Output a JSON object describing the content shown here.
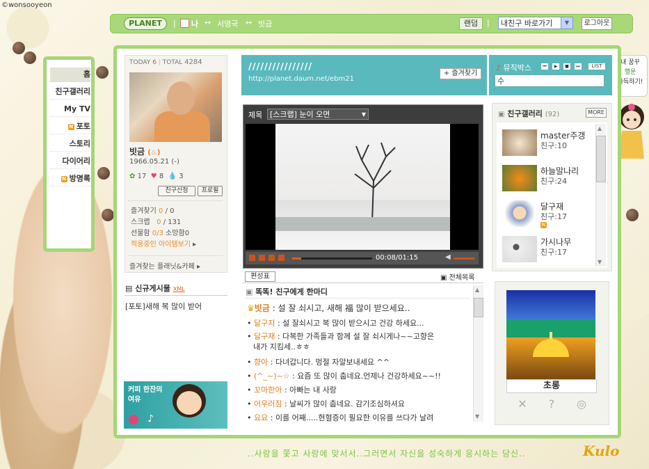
{
  "watermark": "©wonsooyeon",
  "nav": {
    "logo": "PLANET",
    "me": "나",
    "arrow": "↔",
    "person1": "서영국",
    "person2": "빗금",
    "random": "랜덤",
    "friend_select": "내친구 바로가기",
    "logout": "로그아웃"
  },
  "menu": {
    "items": [
      {
        "label": "홈",
        "new": false
      },
      {
        "label": "친구갤러리",
        "new": false
      },
      {
        "label": "My TV",
        "new": false
      },
      {
        "label": "포토",
        "new": true
      },
      {
        "label": "스토리",
        "new": false
      },
      {
        "label": "다이어리",
        "new": false
      },
      {
        "label": "방명록",
        "new": true
      }
    ],
    "new_badge": "N"
  },
  "profile": {
    "today_label": "TODAY",
    "today_value": "6",
    "total_label": "TOTAL",
    "total_value": "4284",
    "name": "빗금",
    "birth": "1966.05.21 (-)",
    "stat1": "17",
    "stat2": "8",
    "stat3": "3",
    "btn_friend": "친구신청",
    "btn_profile": "프로필",
    "fav_label": "즐겨찾기",
    "fav_value": "0",
    "fav_total": "/ 0",
    "scrap_label": "스크랩",
    "scrap_value": "0",
    "scrap_total": "/ 131",
    "gift_label": "선물함",
    "gift_value": "0/3",
    "wish_label": "소망함",
    "wish_value": "0",
    "items_link": "적용중인 아이템보기",
    "planet_link": "즐겨찾는 플래닛&카페",
    "new_posts_title": "신규게시물",
    "xml": "XML",
    "new_post_item": "[포토]새해 복 많이 받어",
    "ad_line1": "커피 한잔의",
    "ad_line2": "여유"
  },
  "banner": {
    "title": "////////////////",
    "url": "http://planet.daum.net/ebm21",
    "fav_button": "+ 즐겨찾기"
  },
  "music": {
    "title": "뮤직박스",
    "list": "LIST",
    "input_value": "수"
  },
  "player": {
    "title_label": "제목",
    "title_value": "[스크랩] 눈이 오면",
    "time": "00:08/01:15",
    "progress": 0.11
  },
  "tv": {
    "edit_button": "편성표",
    "full_list": "전체목록"
  },
  "comments": {
    "title": "똑똑! 친구에게 한마디",
    "items": [
      {
        "who": "빗금",
        "text": " : 설 잘 쇠시고, 새해 福 많이 받으세요.."
      },
      {
        "who": "달구지",
        "text": " : 설 잘쇠시고 복 많이 받으시고 건강 하세요..."
      },
      {
        "who": "달구재",
        "text": " : 다복한 가족들과 함께 설 잘 쇠시게나~~고향은"
      },
      {
        "who": "",
        "text": "내가 지킴세..ㅎㅎ"
      },
      {
        "who": "향아",
        "text": " : 다녀갑니다. 멍절 자알보내세요 ^^"
      },
      {
        "who": "(^_~)~☆",
        "text": " : 요즘 또 많이 춥네요.언제나 건강하세요~~!!"
      },
      {
        "who": "꼬마한아",
        "text": " : 아빠는 내 사랑"
      },
      {
        "who": "어우러짐",
        "text": " : 날씨가 많이 춥네요. 감기조심하셔요"
      },
      {
        "who": "요요",
        "text": " : 이를 어째.....현혈증이 필요한 이유를 쓰다가 날려"
      }
    ]
  },
  "gallery": {
    "title": "친구갤러리",
    "count": "(92)",
    "more": "MORE",
    "items": [
      {
        "name": "master주갱",
        "count": "친구:10",
        "new": false
      },
      {
        "name": "하늘말나리",
        "count": "친구:24",
        "new": false
      },
      {
        "name": "달구재",
        "count": "친구:17",
        "new": true
      },
      {
        "name": "가시나무",
        "count": "친구:17",
        "new": false
      }
    ]
  },
  "widget": {
    "label": "초롱"
  },
  "note": {
    "line1": "내 꿈꾸",
    "line2": "행운",
    "line3": "가득하기!"
  },
  "footer": {
    "slogan": "..사랑을 쫓고 사랑에 맞서서..그러면서 자신을 성숙하게 응시하는 당신..",
    "logo": "Kulo"
  },
  "colors": {
    "frame_green": "#a5d676",
    "banner_teal": "#5ab9bd",
    "accent_orange": "#e07d1a"
  }
}
